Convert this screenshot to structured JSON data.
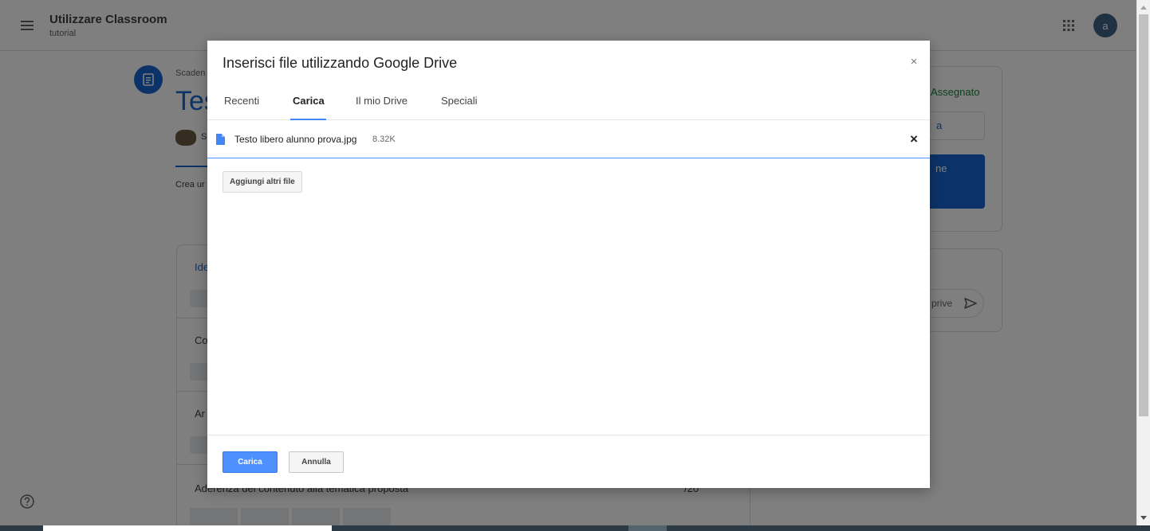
{
  "app": {
    "title": "Utilizzare Classroom",
    "subtitle": "tutorial",
    "avatar_letter": "a"
  },
  "background": {
    "deadline_fragment": "Scaden",
    "title_fragment": "Tes",
    "owner_fragment": "S",
    "instructions_fragment": "Crea ur",
    "rubric_rows": [
      {
        "label_fragment": "Ide"
      },
      {
        "label_fragment": "Co"
      },
      {
        "label_fragment": "Ar"
      }
    ],
    "rubric_last_label": "Aderenza del contenuto alla tematica proposta",
    "rubric_last_score": "/20",
    "work_status": "Assegnato",
    "work_add_fragment": "a",
    "work_submit_fragment": "ne",
    "comment_placeholder_fragment": "prive"
  },
  "dialog": {
    "title": "Inserisci file utilizzando Google Drive",
    "close_glyph": "×",
    "tabs": [
      {
        "label": "Recenti"
      },
      {
        "label": "Carica"
      },
      {
        "label": "Il mio Drive"
      },
      {
        "label": "Speciali"
      }
    ],
    "active_tab": "Carica",
    "file": {
      "name": "Testo libero alunno prova.jpg",
      "size": "8.32K",
      "remove_glyph": "×"
    },
    "add_more_label": "Aggiungi altri file",
    "upload_label": "Carica",
    "cancel_label": "Annulla"
  },
  "colors": {
    "accent_blue": "#4d90fe",
    "classroom_blue": "#1967d2",
    "assigned_green": "#188038"
  }
}
